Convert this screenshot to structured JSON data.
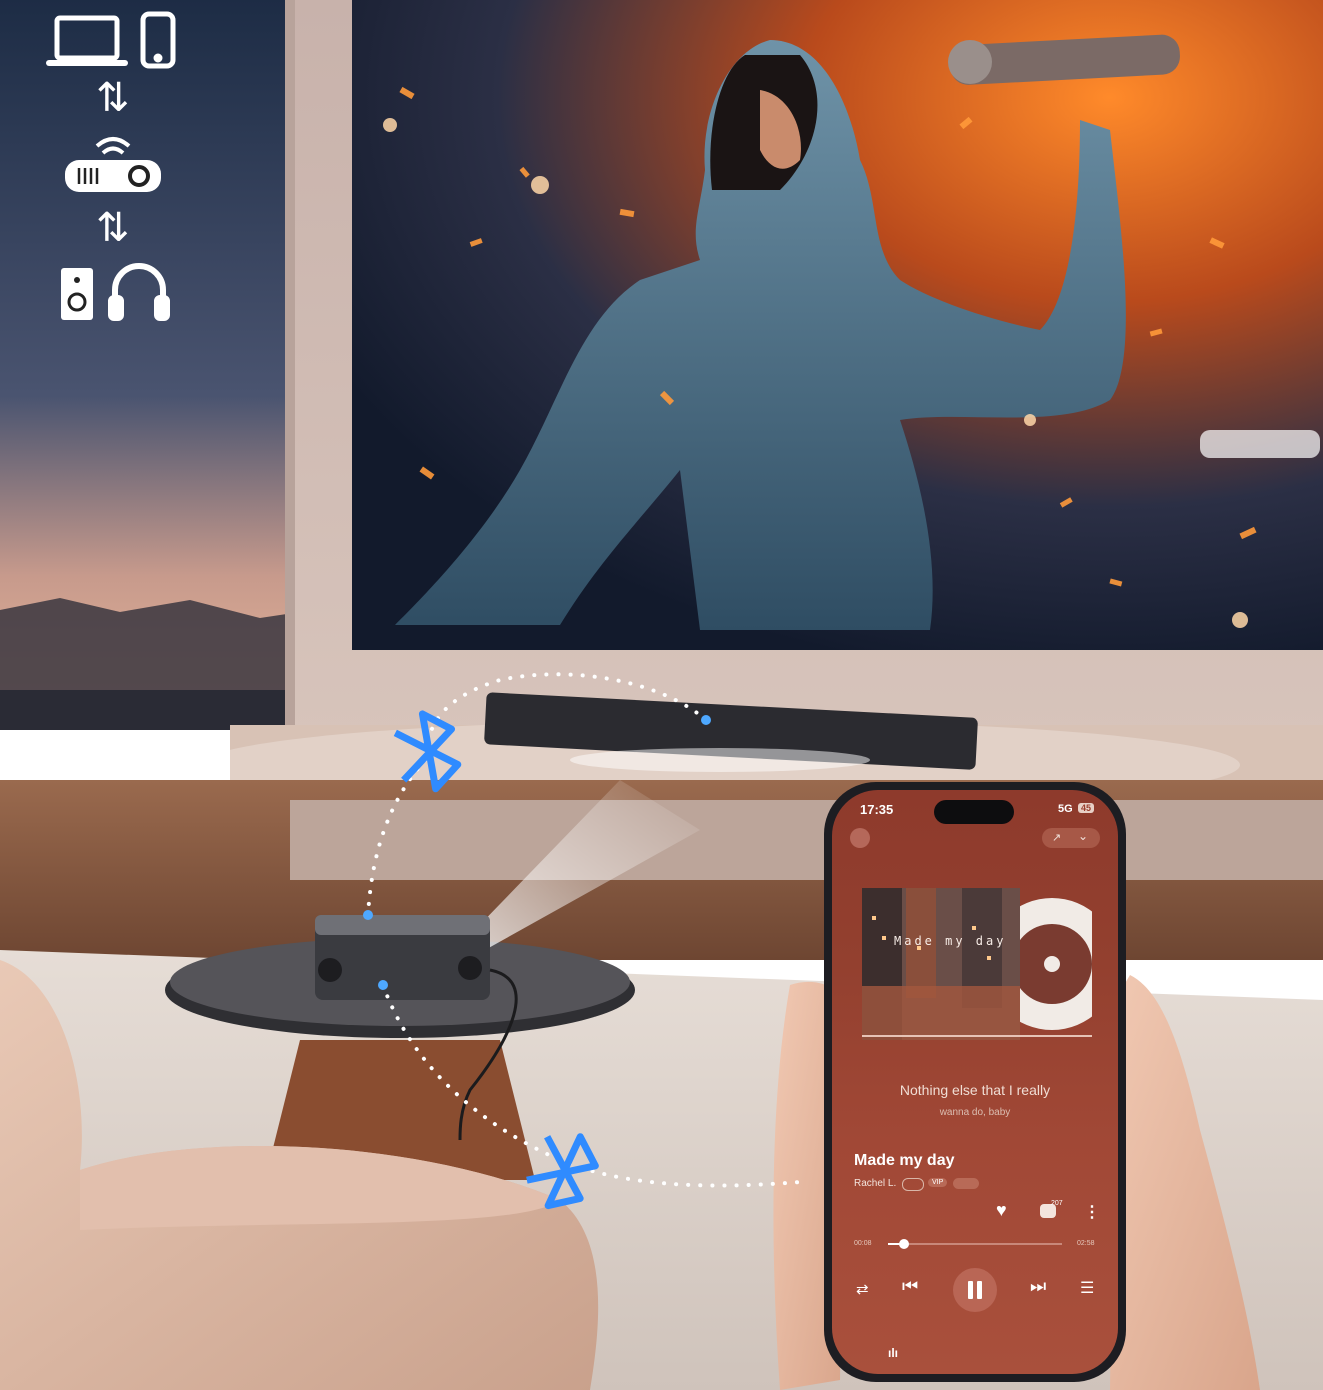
{
  "colors": {
    "bluetooth_accent": "#2f8bff",
    "phone_screen": "#983f2f",
    "screen_glow": "#ff7a22",
    "wall": "#cdb9b1"
  },
  "connection_icons": {
    "row1": [
      "laptop-icon",
      "smartphone-icon"
    ],
    "row2": [
      "projector-icon"
    ],
    "row3": [
      "speaker-icon",
      "headphones-icon"
    ],
    "arrows": "⇅"
  },
  "phone": {
    "status_time": "17:35",
    "network": "5G",
    "battery": "45",
    "album_title": "Made my day",
    "lyric_line1": "Nothing else that I really",
    "lyric_line2": "wanna do, baby",
    "song_title": "Made my day",
    "artist": "Rachel L.",
    "badge_vip": "VIP",
    "comment_count": "207",
    "time_elapsed": "00:08",
    "time_total": "02:58",
    "progress": 0.09
  }
}
